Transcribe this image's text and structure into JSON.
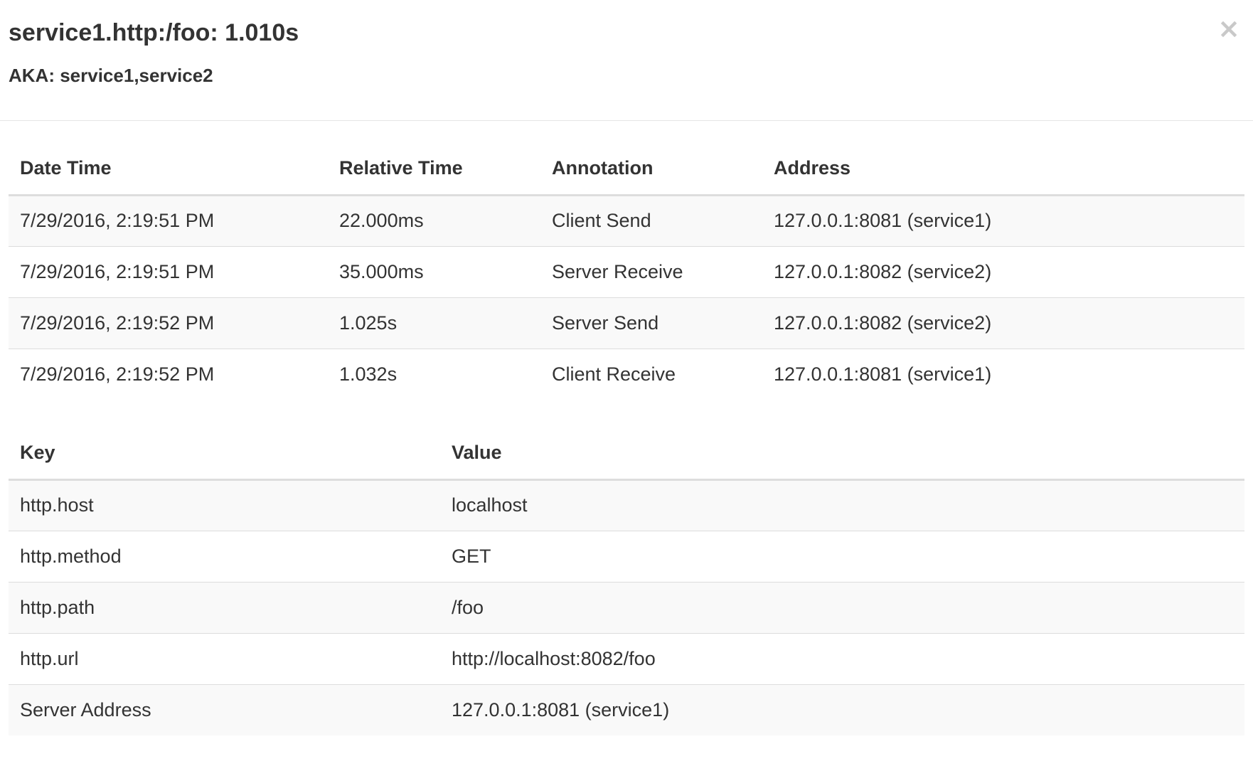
{
  "modal": {
    "title": "service1.http:/foo: 1.010s",
    "aka": "AKA: service1,service2",
    "close_label": "×"
  },
  "annotations": {
    "columns": [
      "Date Time",
      "Relative Time",
      "Annotation",
      "Address"
    ],
    "rows": [
      [
        "7/29/2016, 2:19:51 PM",
        "22.000ms",
        "Client Send",
        "127.0.0.1:8081 (service1)"
      ],
      [
        "7/29/2016, 2:19:51 PM",
        "35.000ms",
        "Server Receive",
        "127.0.0.1:8082 (service2)"
      ],
      [
        "7/29/2016, 2:19:52 PM",
        "1.025s",
        "Server Send",
        "127.0.0.1:8082 (service2)"
      ],
      [
        "7/29/2016, 2:19:52 PM",
        "1.032s",
        "Client Receive",
        "127.0.0.1:8081 (service1)"
      ]
    ]
  },
  "binary_annotations": {
    "columns": [
      "Key",
      "Value"
    ],
    "rows": [
      [
        "http.host",
        "localhost"
      ],
      [
        "http.method",
        "GET"
      ],
      [
        "http.path",
        "/foo"
      ],
      [
        "http.url",
        "http://localhost:8082/foo"
      ],
      [
        "Server Address",
        "127.0.0.1:8081 (service1)"
      ]
    ]
  },
  "colors": {
    "text": "#333333",
    "stripe": "#f9f9f9",
    "border": "#dddddd",
    "close_icon": "#c9c9c9"
  }
}
